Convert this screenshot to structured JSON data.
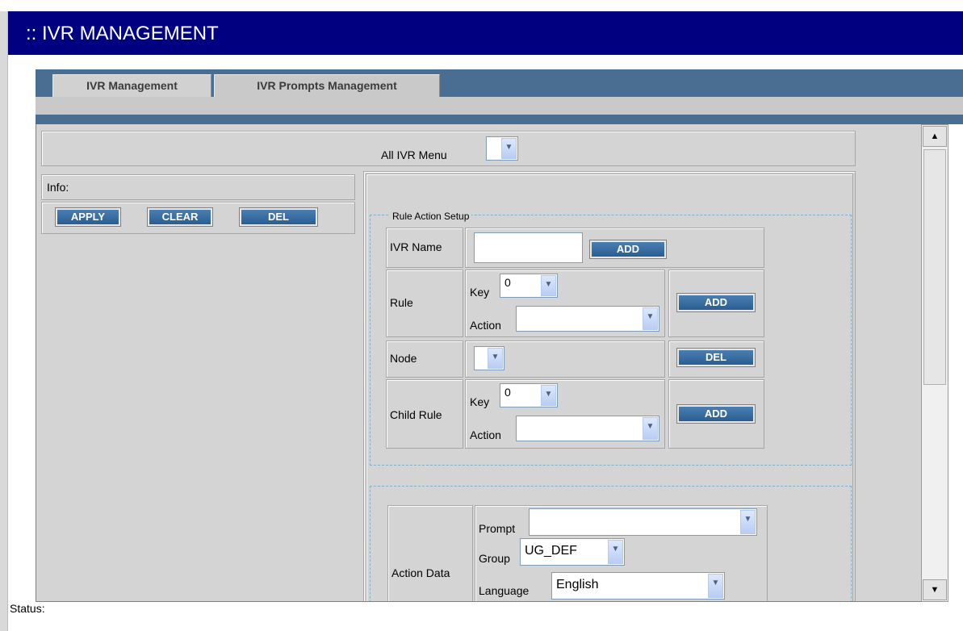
{
  "page": {
    "title": ":: IVR MANAGEMENT",
    "status_label": "Status:"
  },
  "tabs": [
    "IVR Management",
    "IVR Prompts Management"
  ],
  "menu": {
    "label": "All IVR Menu"
  },
  "info": {
    "label": "Info:"
  },
  "left_buttons": {
    "apply": "APPLY",
    "clear": "CLEAR",
    "del": "DEL"
  },
  "rule_action_setup": {
    "legend": "Rule Action Setup",
    "ivr_name": {
      "label": "IVR Name",
      "value": "",
      "button": "ADD"
    },
    "rule": {
      "label": "Rule",
      "key_label": "Key",
      "key_value": "0",
      "action_label": "Action",
      "action_value": "",
      "button": "ADD"
    },
    "node": {
      "label": "Node",
      "value": "",
      "button": "DEL"
    },
    "child_rule": {
      "label": "Child Rule",
      "key_label": "Key",
      "key_value": "0",
      "action_label": "Action",
      "action_value": "",
      "button": "ADD"
    }
  },
  "action_data": {
    "label": "Action Data",
    "prompt": {
      "label": "Prompt",
      "value": ""
    },
    "group": {
      "label": "Group",
      "value": "UG_DEF"
    },
    "language": {
      "label": "Language",
      "value": "English"
    }
  },
  "icons": {
    "dropdown": "chevron-down-icon",
    "scroll_up": "arrow-up-icon",
    "scroll_down": "arrow-down-icon"
  }
}
